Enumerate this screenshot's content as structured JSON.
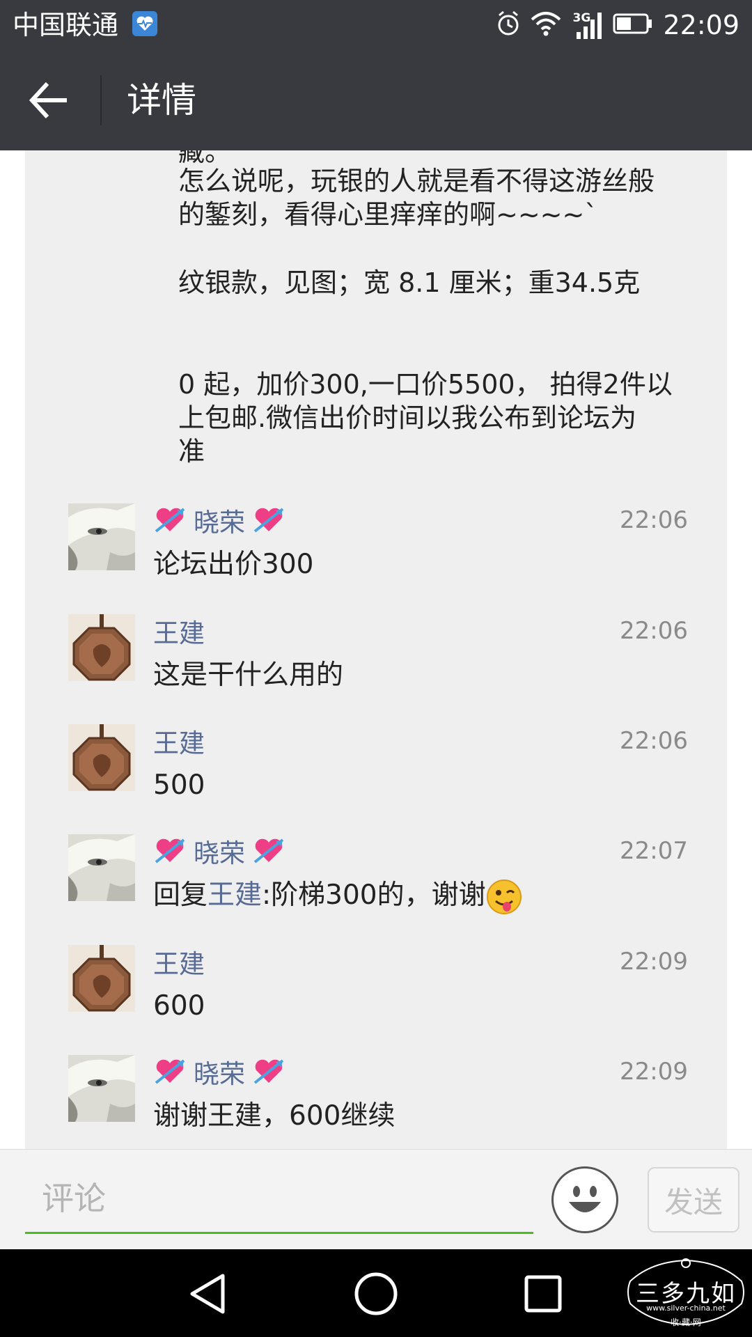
{
  "status_bar": {
    "carrier": "中国联通",
    "network_type": "3G",
    "time": "22:09",
    "icons": [
      "health-icon",
      "alarm-icon",
      "wifi-icon",
      "signal-icon",
      "battery-icon"
    ]
  },
  "header": {
    "title": "详情",
    "back_icon": "arrow-left-icon"
  },
  "post": {
    "lines": [
      "藏。",
      "怎么说呢，玩银的人就是看不得这游丝般",
      "的錾刻，看得心里痒痒的啊~~~~`",
      "纹银款，见图；宽 8.1 厘米；重34.5克",
      "0 起，加价300,一口价5500， 拍得2件以",
      "上包邮.微信出价时间以我公布到论坛为",
      "准"
    ]
  },
  "comments": [
    {
      "name": "晓荣",
      "decorated": true,
      "time": "22:06",
      "text": "论坛出价300",
      "avatar": "face"
    },
    {
      "name": "王建",
      "decorated": false,
      "time": "22:06",
      "text": "这是干什么用的",
      "avatar": "pendant"
    },
    {
      "name": "王建",
      "decorated": false,
      "time": "22:06",
      "text": "500",
      "avatar": "pendant"
    },
    {
      "name": "晓荣",
      "decorated": true,
      "time": "22:07",
      "reply_prefix": "回复",
      "reply_to": "王建",
      "text": ":阶梯300的，谢谢",
      "emoji": "winking-tongue-emoji",
      "avatar": "face"
    },
    {
      "name": "王建",
      "decorated": false,
      "time": "22:09",
      "text": "600",
      "avatar": "pendant"
    },
    {
      "name": "晓荣",
      "decorated": true,
      "time": "22:09",
      "text": "谢谢王建，600继续",
      "avatar": "face"
    }
  ],
  "input_bar": {
    "placeholder": "评论",
    "send_label": "发送",
    "accent_color": "#45c01a"
  },
  "watermark": {
    "text": "三多九如",
    "url": "www.silver-china.net",
    "subtitle": "收·藏·网"
  },
  "colors": {
    "header_bg": "#393a3f",
    "panel_bg": "#efefef",
    "link_name": "#576b95",
    "time": "#8a8a8a"
  }
}
